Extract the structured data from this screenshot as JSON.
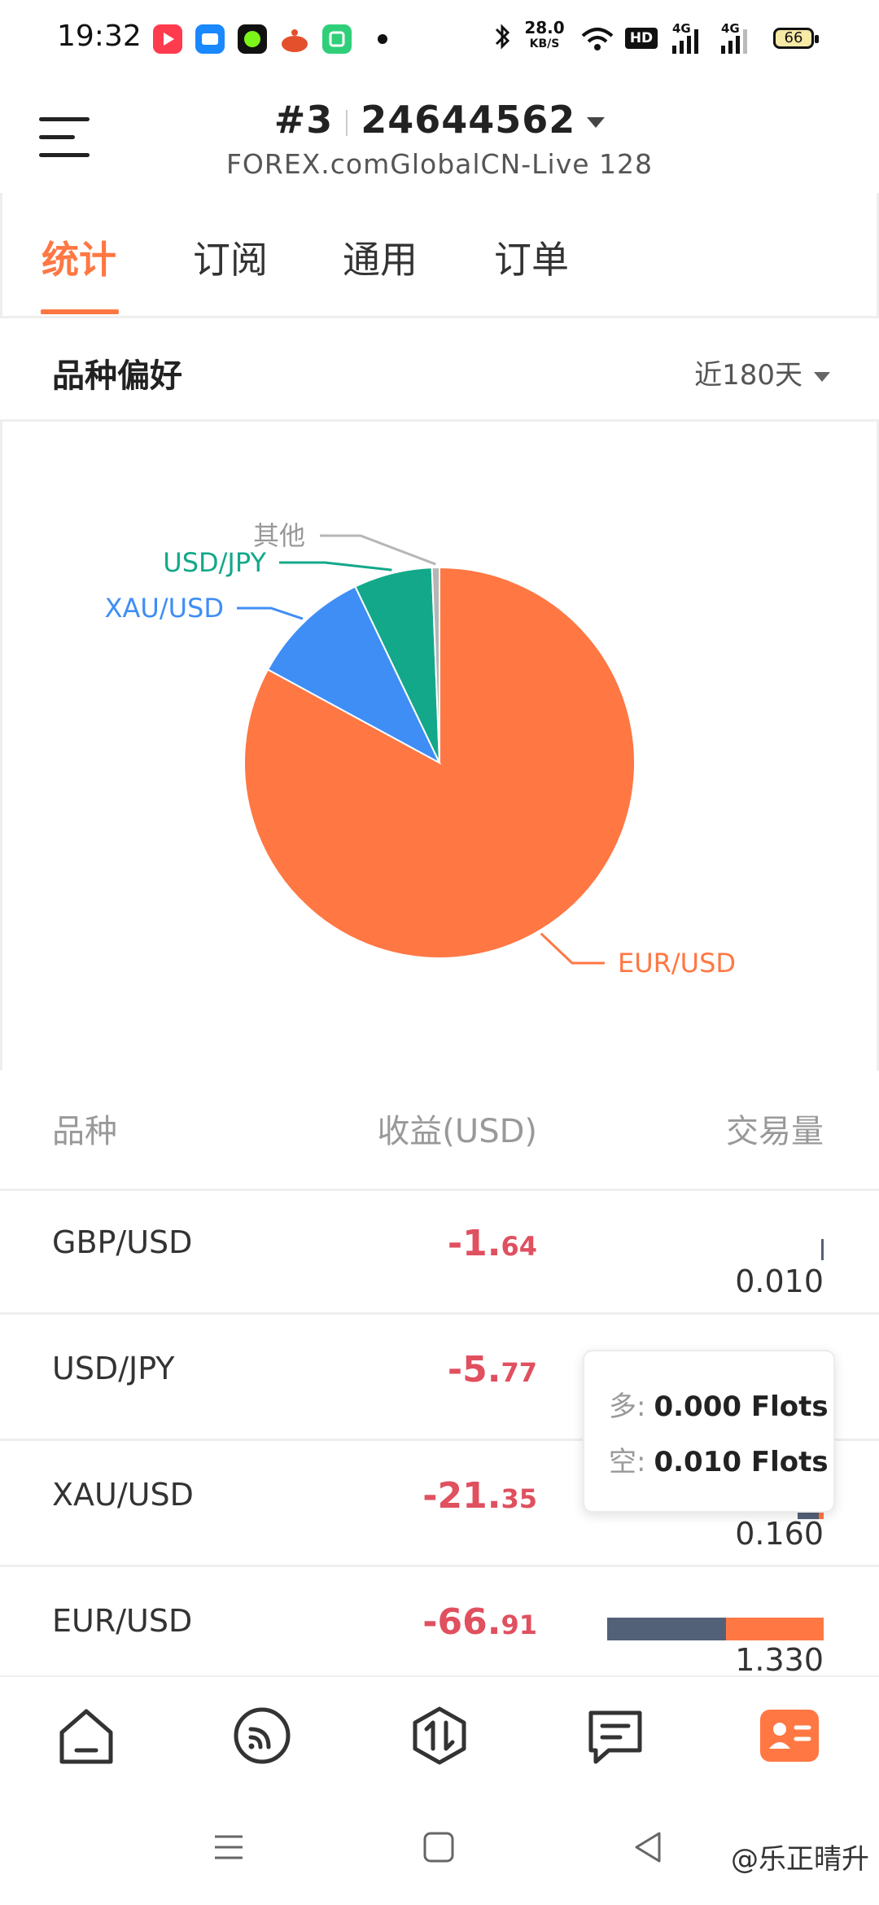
{
  "status_bar": {
    "time": "19:32",
    "net_speed_value": "28.0",
    "net_speed_unit": "KB/S",
    "hd_label": "HD",
    "signal1": "4G",
    "signal2": "4G",
    "battery": "66"
  },
  "header": {
    "account_index": "#3",
    "account_number": "24644562",
    "server": "FOREX.comGlobalCN-Live 128"
  },
  "tabs": [
    {
      "label": "统计",
      "active": true
    },
    {
      "label": "订阅",
      "active": false
    },
    {
      "label": "通用",
      "active": false
    },
    {
      "label": "订单",
      "active": false
    }
  ],
  "section": {
    "title": "品种偏好",
    "range": "近180天"
  },
  "chart_data": {
    "type": "pie",
    "slices": [
      {
        "label": "EUR/USD",
        "value": 0.8292,
        "color": "#ff7743"
      },
      {
        "label": "XAU/USD",
        "value": 0.0998,
        "color": "#3f8ef5"
      },
      {
        "label": "USD/JPY",
        "value": 0.0648,
        "color": "#13a88a"
      },
      {
        "label": "其他",
        "value": 0.0062,
        "color": "#b5b5b5"
      }
    ]
  },
  "table": {
    "headers": {
      "symbol": "品种",
      "profit": "收益(USD)",
      "volume": "交易量"
    },
    "rows": [
      {
        "symbol": "GBP/USD",
        "profit_int": "-1.",
        "profit_dec": "64",
        "volume": "0.010",
        "long_frac": 0.0,
        "short_frac": 0.0
      },
      {
        "symbol": "USD/JPY",
        "profit_int": "-5.",
        "profit_dec": "77",
        "volume": "",
        "long_frac": 0.0,
        "short_frac": 0.0
      },
      {
        "symbol": "XAU/USD",
        "profit_int": "-21.",
        "profit_dec": "35",
        "volume": "0.160",
        "long_frac": 0.0,
        "short_frac": 0.0
      },
      {
        "symbol": "EUR/USD",
        "profit_int": "-66.",
        "profit_dec": "91",
        "volume": "1.330",
        "long_frac": 0.55,
        "short_frac": 0.45
      }
    ]
  },
  "tooltip": {
    "long_key": "多:",
    "long_value": "0.000 Flots",
    "short_key": "空:",
    "short_value": "0.010 Flots"
  },
  "watermark": "@乐正晴升",
  "colors": {
    "accent": "#ff7743",
    "loss": "#e0505f",
    "long_bar": "#536178",
    "short_bar": "#ff7743"
  },
  "icons": [
    "home-icon",
    "feed-icon",
    "trade-icon",
    "notes-icon",
    "profile-icon"
  ]
}
